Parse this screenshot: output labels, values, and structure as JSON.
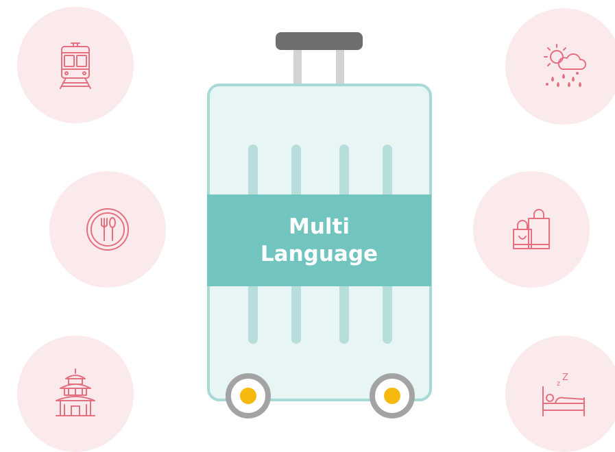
{
  "label": {
    "line1": "Multi",
    "line2": "Language"
  },
  "icons": [
    {
      "name": "train-icon"
    },
    {
      "name": "dining-plate-icon"
    },
    {
      "name": "temple-icon"
    },
    {
      "name": "weather-icon"
    },
    {
      "name": "shopping-bags-icon"
    },
    {
      "name": "sleeping-bed-icon"
    }
  ],
  "colors": {
    "circle_bg": "#fbeaeb",
    "icon_stroke": "#e46f80",
    "suitcase_body": "#e8f5f5",
    "suitcase_border": "#a7d9d6",
    "band": "#72c4bf",
    "stripe": "#b7dedb",
    "handle": "#6f6f6f",
    "wheel_hub": "#f6b90f"
  }
}
